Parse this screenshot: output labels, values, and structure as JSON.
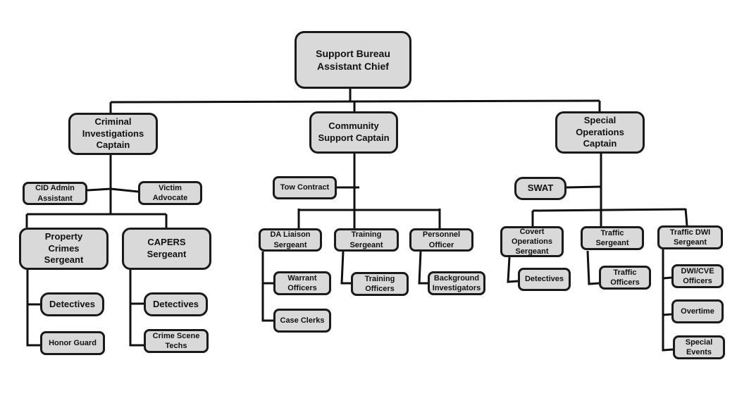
{
  "nodes": {
    "root": "Support Bureau\nAssistant Chief",
    "cid_captain": "Criminal\nInvestigations\nCaptain",
    "community_captain": "Community\nSupport Captain",
    "special_captain": "Special\nOperations\nCaptain",
    "cid_admin": "CID Admin\nAssistant",
    "victim_advocate": "Victim\nAdvocate",
    "property_sergeant": "Property\nCrimes\nSergeant",
    "capers_sergeant": "CAPERS\nSergeant",
    "property_detectives": "Detectives",
    "honor_guard": "Honor Guard",
    "capers_detectives": "Detectives",
    "crime_scene": "Crime Scene\nTechs",
    "tow_contract": "Tow Contract",
    "da_liaison": "DA Liaison\nSergeant",
    "training_sergeant": "Training\nSergeant",
    "personnel_officer": "Personnel\nOfficer",
    "warrant_officers": "Warrant\nOfficers",
    "training_officers": "Training\nOfficers",
    "background": "Background\nInvestigators",
    "case_clerks": "Case Clerks",
    "swat": "SWAT",
    "covert_sergeant": "Covert\nOperations\nSergeant",
    "traffic_sergeant": "Traffic\nSergeant",
    "dwi_sergeant": "Traffic DWI\nSergeant",
    "covert_detectives": "Detectives",
    "traffic_officers": "Traffic\nOfficers",
    "dwi_cve": "DWI/CVE\nOfficers",
    "overtime": "Overtime",
    "special_events": "Special\nEvents"
  },
  "colors": {
    "box_fill": "#d9d9d9",
    "line": "#111111"
  }
}
